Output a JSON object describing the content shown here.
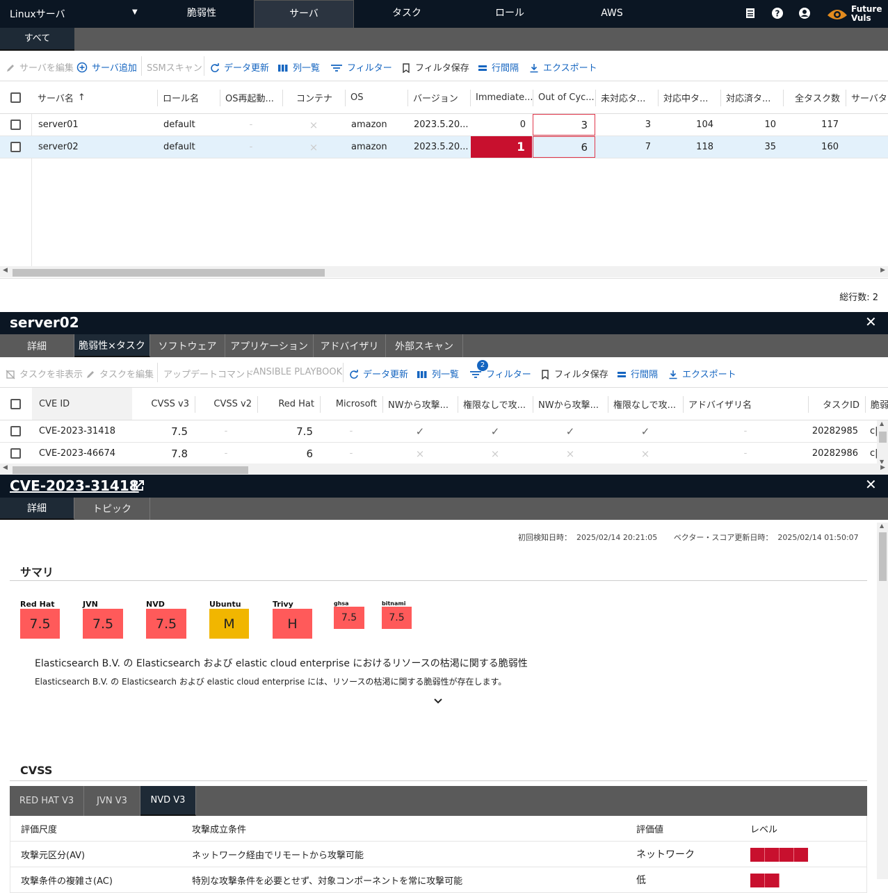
{
  "topbar": {
    "org": "Linuxサーバ",
    "nav": [
      "脆弱性",
      "サーバ",
      "タスク",
      "ロール",
      "AWS"
    ],
    "active_nav": 1,
    "logo_line1": "Future",
    "logo_line2": "Vuls"
  },
  "subtab": "すべて",
  "server_toolbar": {
    "edit_server": "サーバを編集",
    "add_server": "サーバ追加",
    "ssm_scan": "SSMスキャン",
    "refresh": "データ更新",
    "columns": "列一覧",
    "filter": "フィルター",
    "save_filter": "フィルタ保存",
    "row_spacing": "行間隔",
    "export": "エクスポート"
  },
  "server_table": {
    "headers": [
      "サーバ名",
      "ロール名",
      "OS再起動...",
      "コンテナ",
      "OS",
      "バージョン",
      "Immediate...",
      "Out of Cyc...",
      "未対応タ...",
      "対応中タ...",
      "対応済タ...",
      "全タスク数",
      "サーバタ"
    ],
    "rows": [
      {
        "name": "server01",
        "role": "default",
        "reboot": "-",
        "container": "×",
        "os": "amazon",
        "version": "2023.5.20...",
        "immediate": "0",
        "ooc": "3",
        "open": "3",
        "inprogress": "104",
        "done": "10",
        "total": "117"
      },
      {
        "name": "server02",
        "role": "default",
        "reboot": "-",
        "container": "×",
        "os": "amazon",
        "version": "2023.5.20...",
        "immediate": "1",
        "ooc": "6",
        "open": "7",
        "inprogress": "118",
        "done": "35",
        "total": "160"
      }
    ],
    "total_rows": "総行数: 2"
  },
  "server_panel": {
    "title": "server02",
    "tabs": [
      "詳細",
      "脆弱性×タスク",
      "ソフトウェア",
      "アプリケーション",
      "アドバイザリ",
      "外部スキャン"
    ],
    "active_tab": 1
  },
  "task_toolbar": {
    "hide_task": "タスクを非表示",
    "edit_task": "タスクを編集",
    "update_cmd": "アップデートコマンド",
    "ansible": "ANSIBLE PLAYBOOK",
    "refresh": "データ更新",
    "columns": "列一覧",
    "filter": "フィルター",
    "filter_count": "2",
    "save_filter": "フィルタ保存",
    "row_spacing": "行間隔",
    "export": "エクスポート"
  },
  "cve_table": {
    "headers": [
      "CVE ID",
      "CVSS v3",
      "CVSS v2",
      "Red Hat",
      "Microsoft",
      "NWから攻撃...",
      "権限なしで攻...",
      "NWから攻撃...",
      "権限なしで攻...",
      "アドバイザリ名",
      "タスクID",
      "脆弱"
    ],
    "rows": [
      {
        "id": "CVE-2023-31418",
        "v3": "7.5",
        "v2": "-",
        "redhat": "7.5",
        "ms": "-",
        "c1": "✓",
        "c2": "✓",
        "c3": "✓",
        "c4": "✓",
        "adv": "-",
        "task": "20282985",
        "extra": "c|"
      },
      {
        "id": "CVE-2023-46674",
        "v3": "7.8",
        "v2": "-",
        "redhat": "6",
        "ms": "-",
        "c1": "×",
        "c2": "×",
        "c3": "×",
        "c4": "×",
        "adv": "-",
        "task": "20282986",
        "extra": "c|"
      }
    ]
  },
  "cve_panel": {
    "title": "CVE-2023-31418",
    "tabs": [
      "詳細",
      "トピック"
    ],
    "active_tab": 0,
    "first_detected_label": "初回検知日時：",
    "first_detected": "2025/02/14 20:21:05",
    "vector_updated_label": "ベクター・スコア更新日時：",
    "vector_updated": "2025/02/14 01:50:07",
    "summary_title": "サマリ",
    "scores": [
      {
        "label": "Red Hat",
        "value": "7.5",
        "level": "high"
      },
      {
        "label": "JVN",
        "value": "7.5",
        "level": "high"
      },
      {
        "label": "NVD",
        "value": "7.5",
        "level": "high"
      },
      {
        "label": "Ubuntu",
        "value": "M",
        "level": "medium"
      },
      {
        "label": "Trivy",
        "value": "H",
        "level": "high"
      },
      {
        "label": "ghsa",
        "value": "7.5",
        "level": "high"
      },
      {
        "label": "bitnami",
        "value": "7.5",
        "level": "high"
      }
    ],
    "summary_title_text": "Elasticsearch B.V. の Elasticsearch および elastic cloud enterprise におけるリソースの枯渇に関する脆弱性",
    "summary_desc": "Elasticsearch B.V. の Elasticsearch および elastic cloud enterprise には、リソースの枯渇に関する脆弱性が存在します。",
    "cvss_title": "CVSS",
    "cvss_tabs": [
      "RED HAT V3",
      "JVN V3",
      "NVD V3"
    ],
    "cvss_active": 2,
    "cvss_headers": [
      "評価尺度",
      "攻撃成立条件",
      "評価値",
      "レベル"
    ],
    "cvss_rows": [
      {
        "metric": "攻撃元区分(AV)",
        "condition": "ネットワーク経由でリモートから攻撃可能",
        "value": "ネットワーク",
        "level_pct": 100
      },
      {
        "metric": "攻撃条件の複雑さ(AC)",
        "condition": "特別な攻撃条件を必要とせず、対象コンポーネントを常に攻撃可能",
        "value": "低",
        "level_pct": 50
      }
    ]
  },
  "colors": {
    "dark": "#0b1623",
    "accent": "#1565c0",
    "danger": "#c8102e",
    "score_high": "#ff5a5a",
    "score_medium": "#f1b600"
  }
}
